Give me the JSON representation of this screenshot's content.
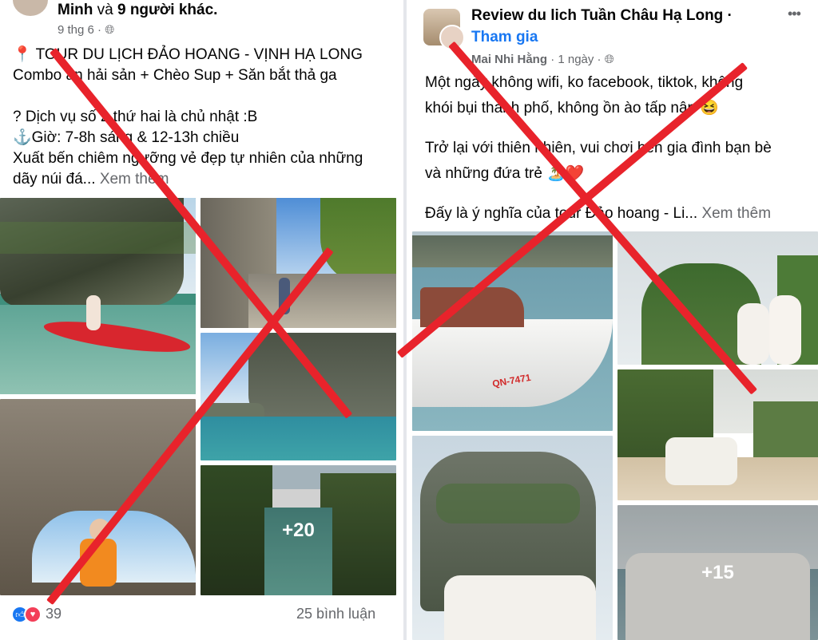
{
  "left_post": {
    "author_line": {
      "name": "Minh",
      "conj": "và",
      "others": "9 người khác."
    },
    "timestamp": "9 thg 6 ·",
    "lines": [
      "📍 TOUR DU LỊCH ĐẢO HOANG - VỊNH HẠ LONG",
      "Combo ăn hải sản + Chèo Sup + Săn bắt thả ga",
      "",
      "? Dịch vụ số 2 thứ hai là chủ nhật :B",
      "⚓Giờ: 7-8h sáng  &  12-13h chiều",
      "Xuất bến chiêm ngưỡng vẻ đẹp tự nhiên của những"
    ],
    "last_line": "dãy núi đá...",
    "see_more": "Xem thêm",
    "more_photos": "+20",
    "reaction_count": "39",
    "comments": "25 bình luận"
  },
  "right_post": {
    "group_name": "Review du lich Tuần Châu Hạ Long ·",
    "join": "Tham gia",
    "author": "Mai Nhi Hằng",
    "timestamp": "· 1 ngày ·",
    "more_menu": "•••",
    "lines": [
      "Một ngày không wifi, ko facebook, tiktok, không",
      "khói bụi thành phố, không ồn ào tấp nập 😆",
      "",
      "Trở lại với thiên nhiên, vui chơi bên gia đình bạn bè",
      "và những đứa trẻ 🏝️❤️",
      ""
    ],
    "last_line": "Đấy là ý nghĩa của tour Đảo hoang - Li...",
    "see_more": "Xem thêm",
    "more_photos": "+15",
    "boat_reg": "QN-7471"
  },
  "colors": {
    "cross": "#e8232b",
    "link": "#1877f2",
    "muted": "#65676b"
  }
}
